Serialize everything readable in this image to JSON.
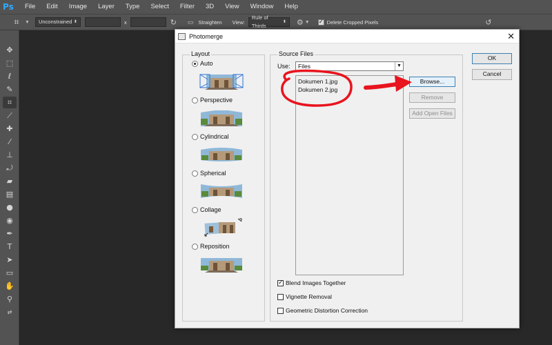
{
  "app": {
    "logo": "Ps"
  },
  "menu": [
    "File",
    "Edit",
    "Image",
    "Layer",
    "Type",
    "Select",
    "Filter",
    "3D",
    "View",
    "Window",
    "Help"
  ],
  "options_bar": {
    "ratio_value": "Unconstrained",
    "x_separator": "x",
    "straighten_label": "Straighten",
    "view_label": "View:",
    "view_value": "Rule of Thirds",
    "delete_cropped_label": "Delete Cropped Pixels",
    "delete_cropped_checked": true
  },
  "toolbar": {
    "icons": [
      "move-icon",
      "marquee-icon",
      "lasso-icon",
      "quick-select-icon",
      "crop-icon",
      "eyedropper-icon",
      "healing-brush-icon",
      "brush-icon",
      "clone-stamp-icon",
      "history-brush-icon",
      "eraser-icon",
      "gradient-icon",
      "blur-icon",
      "dodge-icon",
      "pen-icon",
      "type-icon",
      "path-select-icon",
      "rectangle-icon",
      "hand-icon",
      "zoom-icon"
    ],
    "active": "crop-icon",
    "foreground_color": "#000000",
    "background_color": "#ffffff"
  },
  "dialog": {
    "title": "Photomerge",
    "layout": {
      "legend": "Layout",
      "options": [
        {
          "label": "Auto",
          "selected": true
        },
        {
          "label": "Perspective",
          "selected": false
        },
        {
          "label": "Cylindrical",
          "selected": false
        },
        {
          "label": "Spherical",
          "selected": false
        },
        {
          "label": "Collage",
          "selected": false
        },
        {
          "label": "Reposition",
          "selected": false
        }
      ]
    },
    "source": {
      "legend": "Source Files",
      "use_label": "Use:",
      "use_value": "Files",
      "files": [
        "Dokumen 1.jpg",
        "Dokumen 2.jpg"
      ],
      "browse_label": "Browse...",
      "remove_label": "Remove",
      "add_open_label": "Add Open Files"
    },
    "checkboxes": [
      {
        "label": "Blend Images Together",
        "checked": true
      },
      {
        "label": "Vignette Removal",
        "checked": false
      },
      {
        "label": "Geometric Distortion Correction",
        "checked": false
      }
    ],
    "ok_label": "OK",
    "cancel_label": "Cancel"
  },
  "annotation": {
    "color": "#e8141e"
  }
}
